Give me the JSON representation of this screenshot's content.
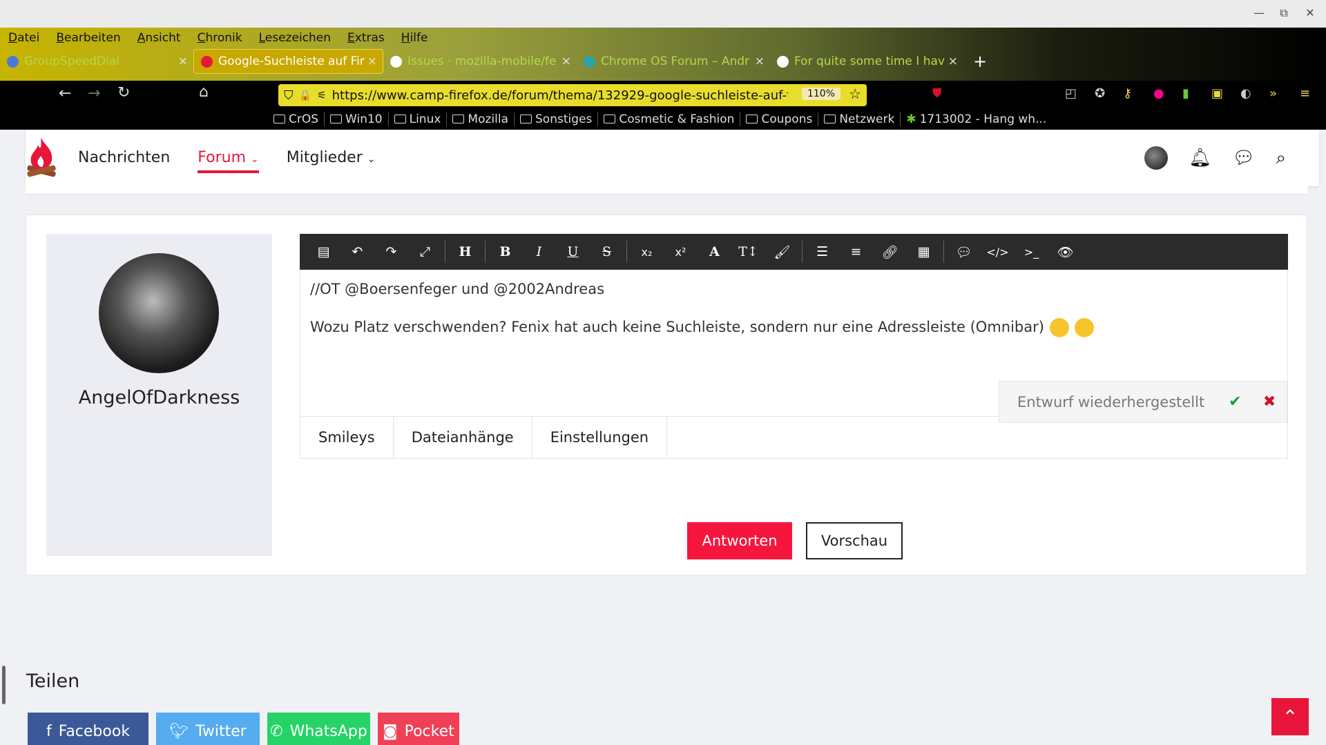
{
  "browser": {
    "window_controls": {
      "minimize": "—",
      "maximize": "⧉",
      "close": "✕"
    },
    "menu": [
      "Datei",
      "Bearbeiten",
      "Ansicht",
      "Chronik",
      "Lesezeichen",
      "Extras",
      "Hilfe"
    ],
    "tabs": [
      {
        "title": "GroupSpeedDial",
        "favicon_color": "#4a79d8"
      },
      {
        "title": "Google-Suchleiste auf Fir",
        "favicon_color": "#e8163a"
      },
      {
        "title": "Issues · mozilla-mobile/fe",
        "favicon_color": "#ffffff"
      },
      {
        "title": "Chrome OS Forum – Andr",
        "favicon_color": "#2da3a8"
      },
      {
        "title": "For quite some time I hav",
        "favicon_color": "#ffffff"
      }
    ],
    "tab_close": "×",
    "new_tab": "+",
    "url": "https://www.camp-firefox.de/forum/thema/132929-google-suchleiste-auf-fi",
    "zoom": "110%",
    "bookmarks": [
      "CrOS",
      "Win10",
      "Linux",
      "Mozilla",
      "Sonstiges",
      "Cosmetic & Fashion",
      "Coupons",
      "Netzwerk",
      "1713002 - Hang wh..."
    ]
  },
  "site": {
    "nav": {
      "nachrichten": "Nachrichten",
      "forum": "Forum",
      "mitglieder": "Mitglieder"
    },
    "accent": "#e8163a"
  },
  "post": {
    "username": "AngelOfDarkness",
    "toolbar_text": {
      "heading": "H",
      "bold": "B",
      "italic": "I",
      "underline": "U",
      "strike": "S"
    },
    "line1": "//OT @Boersenfeger und @2002Andreas",
    "line2": "Wozu Platz verschwenden? Fenix hat auch keine Suchleiste, sondern nur eine Adressleiste (Omnibar)",
    "draft_notice": "Entwurf wiederhergestellt",
    "tabs": {
      "smileys": "Smileys",
      "attachments": "Dateianhänge",
      "settings": "Einstellungen"
    },
    "reply_button": "Antworten",
    "preview_button": "Vorschau"
  },
  "share": {
    "title": "Teilen",
    "buttons": [
      {
        "label": "Facebook",
        "color": "#3b5998"
      },
      {
        "label": "Twitter",
        "color": "#55acee"
      },
      {
        "label": "WhatsApp",
        "color": "#25d366"
      },
      {
        "label": "Pocket",
        "color": "#ef4056"
      }
    ]
  }
}
